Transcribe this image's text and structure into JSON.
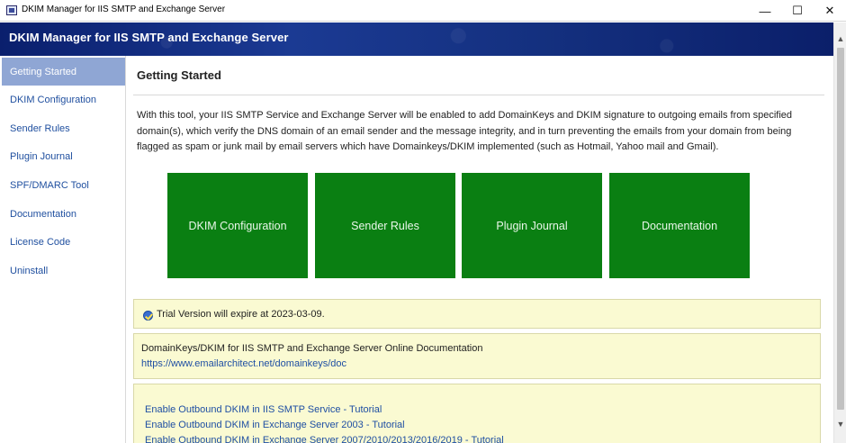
{
  "window": {
    "title": "DKIM Manager for IIS SMTP and Exchange Server",
    "minimize": "—",
    "maximize": "☐",
    "close": "✕"
  },
  "banner": {
    "title": "DKIM Manager for IIS SMTP and Exchange Server"
  },
  "sidebar": {
    "items": [
      {
        "label": "Getting Started",
        "active": true
      },
      {
        "label": "DKIM Configuration"
      },
      {
        "label": "Sender Rules"
      },
      {
        "label": "Plugin Journal"
      },
      {
        "label": "SPF/DMARC Tool"
      },
      {
        "label": "Documentation"
      },
      {
        "label": "License Code"
      },
      {
        "label": "Uninstall"
      }
    ]
  },
  "main": {
    "title": "Getting Started",
    "intro": "With this tool, your IIS SMTP Service and Exchange Server will be enabled to add DomainKeys and DKIM signature to outgoing emails from specified domain(s), which verify the DNS domain of an email sender and the message integrity, and in turn preventing the emails from your domain from being flagged as spam or junk mail by email servers which have Domainkeys/DKIM implemented (such as Hotmail, Yahoo mail and Gmail).",
    "tiles": [
      {
        "label": "DKIM Configuration"
      },
      {
        "label": "Sender Rules"
      },
      {
        "label": "Plugin Journal"
      },
      {
        "label": "Documentation"
      }
    ],
    "tile_color": "#0a7f12",
    "trial": {
      "text": "Trial Version will expire at 2023-03-09."
    },
    "docs": {
      "title": "DomainKeys/DKIM for IIS SMTP and Exchange Server Online Documentation",
      "link": "https://www.emailarchitect.net/domainkeys/doc"
    },
    "tutorials": [
      {
        "label": "Enable Outbound DKIM in IIS SMTP Service - Tutorial"
      },
      {
        "label": "Enable Outbound DKIM in Exchange Server 2003 - Tutorial"
      },
      {
        "label": "Enable Outbound DKIM in Exchange Server 2007/2010/2013/2016/2019 - Tutorial"
      }
    ]
  },
  "colors": {
    "banner": "#14307f",
    "sidebar_active": "#8fa6d4",
    "link": "#1f4fa3",
    "panel_bg": "#fafad2"
  }
}
